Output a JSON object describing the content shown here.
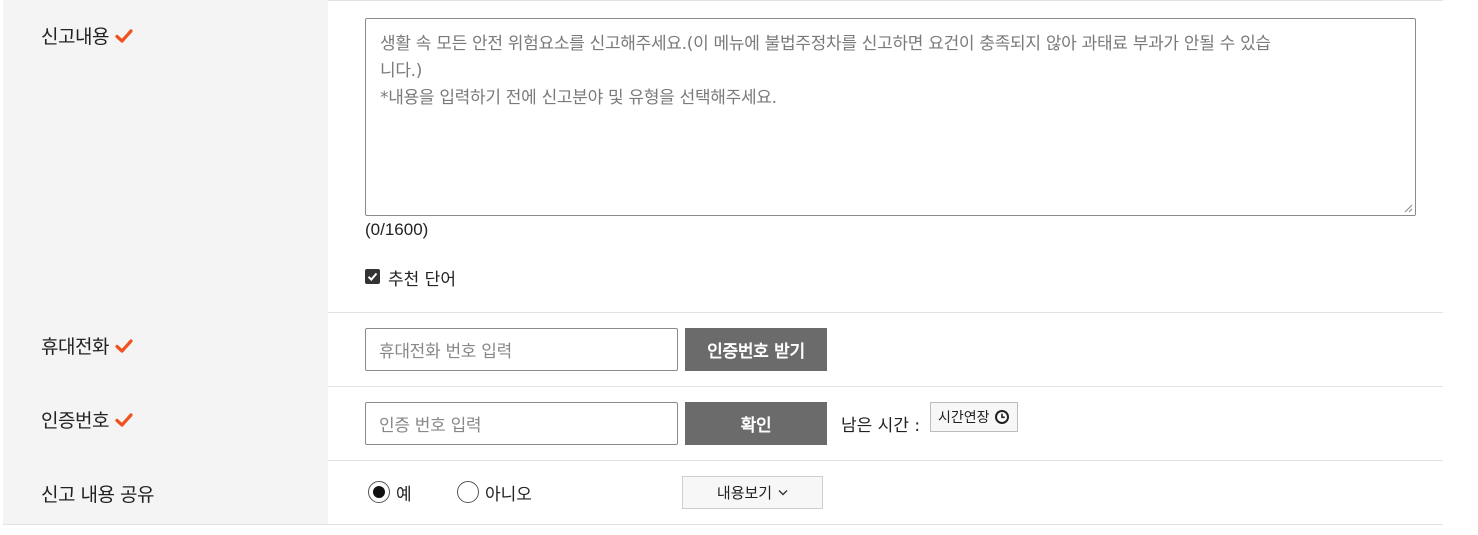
{
  "rows": {
    "content": {
      "label": "신고내용",
      "placeholder_line1": "생활 속 모든 안전 위험요소를 신고해주세요.(이 메뉴에 불법주정차를 신고하면 요건이 충족되지 않아 과태료 부과가 안될 수 있습",
      "placeholder_line2": "니다.)",
      "placeholder_line3": "*내용을 입력하기 전에 신고분야 및 유형을 선택해주세요.",
      "counter": "(0/1600)",
      "recommend_label": "추천 단어",
      "recommend_checked": true
    },
    "phone": {
      "label": "휴대전화",
      "input_placeholder": "휴대전화 번호 입력",
      "request_button": "인증번호 받기"
    },
    "auth": {
      "label": "인증번호",
      "input_placeholder": "인증 번호 입력",
      "confirm_button": "확인",
      "remaining_time_label": "남은 시간 :",
      "extend_button": "시간연장"
    },
    "share": {
      "label": "신고 내용 공유",
      "option_yes": "예",
      "option_no": "아니오",
      "selected": "예",
      "view_button": "내용보기"
    }
  },
  "colors": {
    "required_check": "#f0521e",
    "label_bg": "#f4f4f4",
    "dark_button": "#6b6b6b"
  },
  "icons": {
    "required": "checkmark-icon",
    "extend": "clock-icon",
    "view": "chevron-down-icon"
  }
}
